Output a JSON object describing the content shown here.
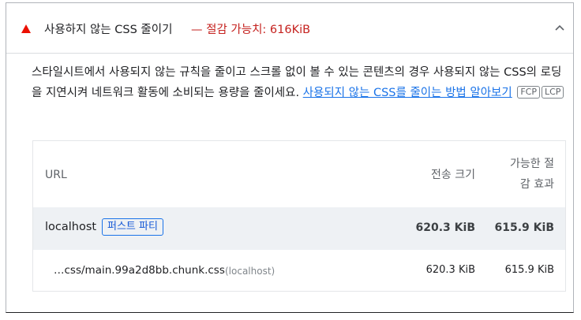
{
  "audit": {
    "title": "사용하지 않는 CSS 줄이기",
    "savings": "— 절감 가능치: 616KiB",
    "status_color": "#eb0f00",
    "description_text": "스타일시트에서 사용되지 않는 규칙을 줄이고 스크롤 없이 볼 수 있는 콘텐츠의 경우 사용되지 않는 CSS의 로딩을 지연시켜 네트워크 활동에 소비되는 용량을 줄이세요. ",
    "learn_more_link": "사용되지 않는 CSS를 줄이는 방법 알아보기",
    "metric_chips": [
      "FCP",
      "LCP"
    ]
  },
  "table": {
    "headers": {
      "url": "URL",
      "transfer_size": "전송 크기",
      "potential_savings_line1": "가능한 절",
      "potential_savings_line2": "감 효과"
    },
    "group": {
      "host": "localhost",
      "badge": "퍼스트 파티",
      "transfer_size": "620.3 KiB",
      "potential_savings": "615.9 KiB"
    },
    "rows": [
      {
        "url": "…css/main.99a2d8bb.chunk.css",
        "host": "(localhost)",
        "transfer_size": "620.3 KiB",
        "potential_savings": "615.9 KiB"
      }
    ]
  }
}
